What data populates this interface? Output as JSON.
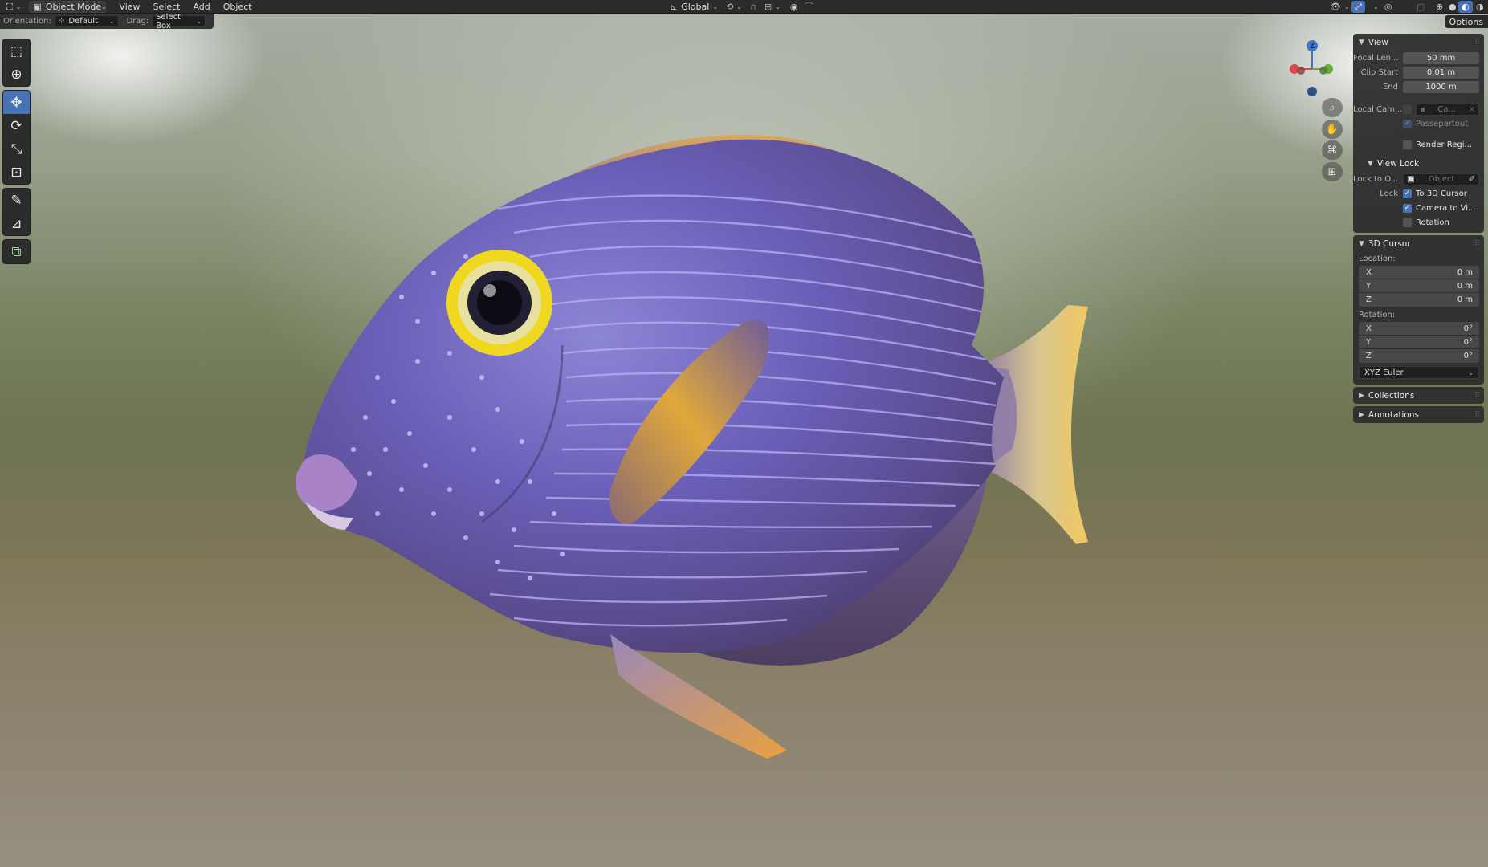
{
  "header": {
    "editor_type_icon": "3d-viewport-icon",
    "mode": {
      "icon": "object-mode-icon",
      "label": "Object Mode"
    },
    "menus": [
      "View",
      "Select",
      "Add",
      "Object"
    ],
    "transform_orientation": {
      "icon": "global-axis-icon",
      "label": "Global"
    },
    "pivot_icon": "pivot-icon",
    "snap_icon": "magnet-icon",
    "proportional_icon": "proportional-edit-icon"
  },
  "tool_settings": {
    "orientation_label": "Orientation:",
    "orientation_value": "Default",
    "drag_label": "Drag:",
    "drag_value": "Select Box",
    "options_label": "Options"
  },
  "toolshelf": {
    "tools": [
      {
        "name": "select-box",
        "icon": "select-box-icon",
        "glyph": "⬚",
        "active": false
      },
      {
        "name": "cursor",
        "icon": "cursor-icon",
        "glyph": "⊕",
        "active": false
      },
      {
        "name": "move",
        "icon": "move-icon",
        "glyph": "✥",
        "active": true
      },
      {
        "name": "rotate",
        "icon": "rotate-icon",
        "glyph": "⟳",
        "active": false
      },
      {
        "name": "scale",
        "icon": "scale-icon",
        "glyph": "⤡",
        "active": false
      },
      {
        "name": "transform",
        "icon": "transform-icon",
        "glyph": "⊡",
        "active": false
      },
      {
        "name": "annotate",
        "icon": "annotate-icon",
        "glyph": "✎",
        "active": false
      },
      {
        "name": "measure",
        "icon": "measure-icon",
        "glyph": "📐",
        "active": false
      },
      {
        "name": "add-cube",
        "icon": "add-cube-icon",
        "glyph": "⧉",
        "active": false
      }
    ]
  },
  "gizmo": {
    "z_label": "Z",
    "colors": {
      "x": "#d94a4a",
      "y": "#6aa83a",
      "z": "#3e77c9"
    }
  },
  "sidebar": {
    "view": {
      "title": "View",
      "focal_length_label": "Focal Len...",
      "focal_length": "50 mm",
      "clip_start_label": "Clip Start",
      "clip_start": "0.01 m",
      "end_label": "End",
      "end": "1000 m",
      "local_camera_label": "Local Cam...",
      "local_camera_value": "Ca...",
      "passepartout": "Passepartout",
      "render_region": "Render Regi...",
      "view_lock_title": "View Lock",
      "lock_to_object_label": "Lock to O...",
      "lock_to_object_placeholder": "Object",
      "lock_label": "Lock",
      "to_3d_cursor": "To 3D Cursor",
      "camera_to_view": "Camera to Vi...",
      "rotation": "Rotation"
    },
    "cursor": {
      "title": "3D Cursor",
      "location_label": "Location:",
      "location": [
        {
          "axis": "X",
          "value": "0 m"
        },
        {
          "axis": "Y",
          "value": "0 m"
        },
        {
          "axis": "Z",
          "value": "0 m"
        }
      ],
      "rotation_label": "Rotation:",
      "rotation": [
        {
          "axis": "X",
          "value": "0°"
        },
        {
          "axis": "Y",
          "value": "0°"
        },
        {
          "axis": "Z",
          "value": "0°"
        }
      ],
      "rotation_mode": "XYZ Euler"
    },
    "collections_title": "Collections",
    "annotations_title": "Annotations"
  },
  "colors": {
    "accent": "#4772b3",
    "panel": "#2d2d2d",
    "field": "#545454"
  }
}
